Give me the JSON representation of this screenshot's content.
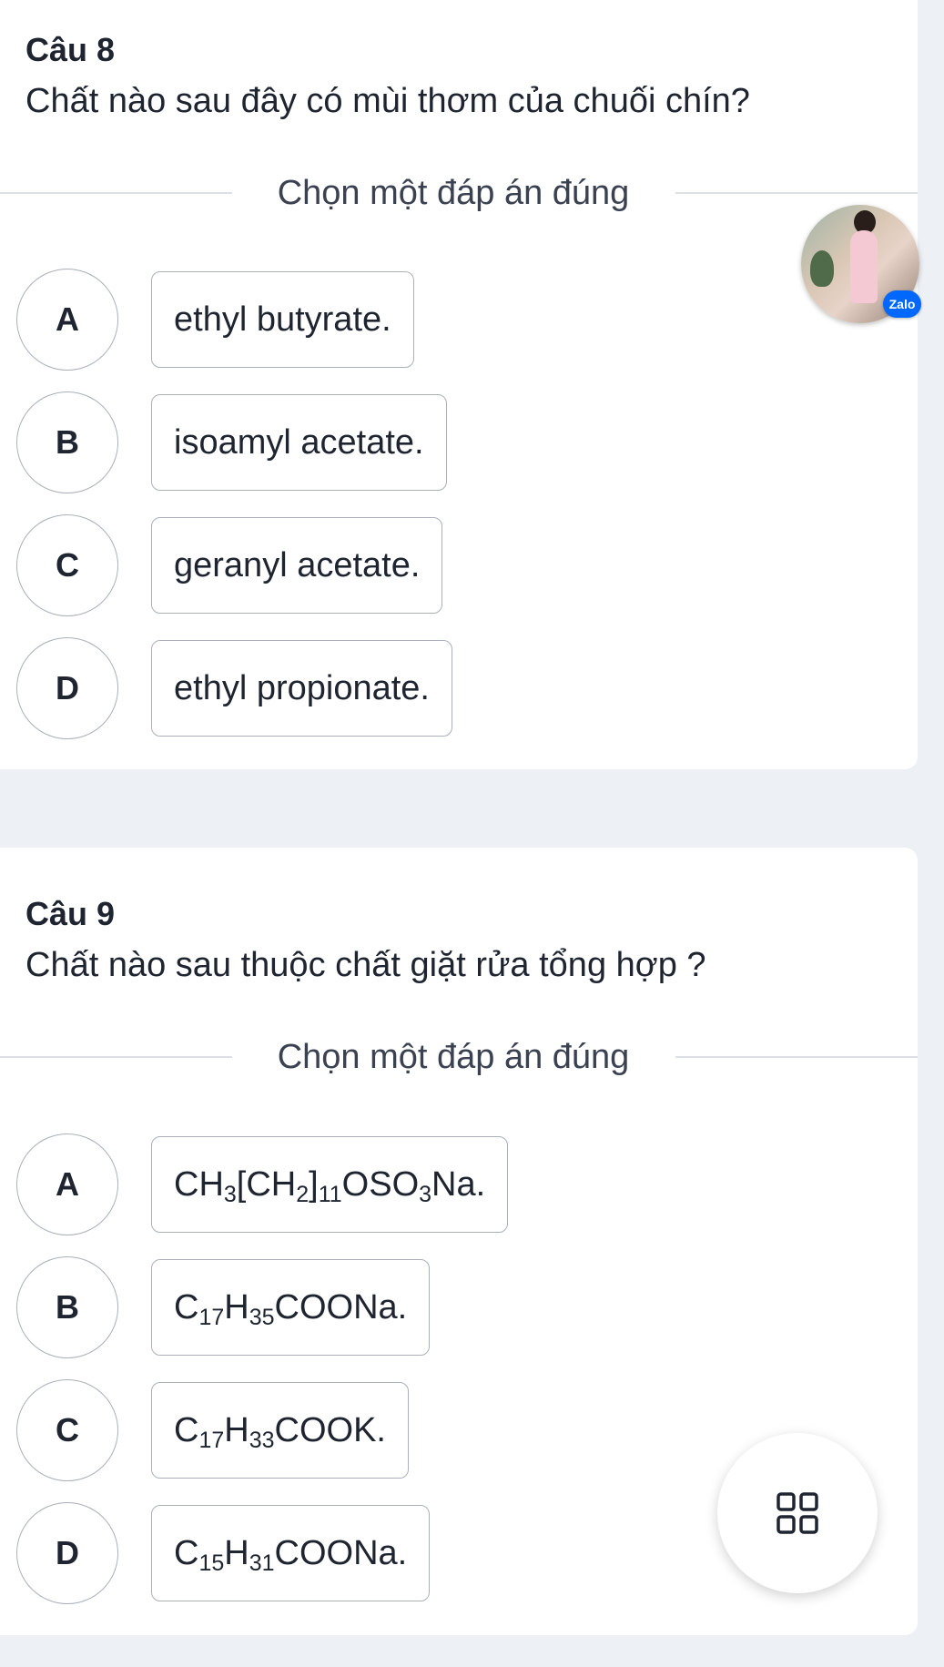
{
  "questions": [
    {
      "number": "Câu 8",
      "text": "Chất nào sau đây có mùi thơm của chuối chín?",
      "prompt": "Chọn một đáp án đúng",
      "options": [
        {
          "letter": "A",
          "text": "ethyl butyrate."
        },
        {
          "letter": "B",
          "text": "isoamyl acetate."
        },
        {
          "letter": "C",
          "text": "geranyl acetate."
        },
        {
          "letter": "D",
          "text": "ethyl propionate."
        }
      ]
    },
    {
      "number": "Câu 9",
      "text": "Chất nào sau thuộc chất giặt rửa tổng hợp ?",
      "prompt": "Chọn một đáp án đúng",
      "options": [
        {
          "letter": "A",
          "parts": [
            [
              "CH",
              "3"
            ],
            [
              "[CH",
              "2"
            ],
            [
              "]",
              "11"
            ],
            [
              "OSO",
              "3"
            ],
            [
              "Na.",
              ""
            ]
          ]
        },
        {
          "letter": "B",
          "parts": [
            [
              "C",
              "17"
            ],
            [
              "H",
              "35"
            ],
            [
              "COONa.",
              ""
            ]
          ]
        },
        {
          "letter": "C",
          "parts": [
            [
              "C",
              "17"
            ],
            [
              "H",
              "33"
            ],
            [
              "COOK.",
              ""
            ]
          ]
        },
        {
          "letter": "D",
          "parts": [
            [
              "C",
              "15"
            ],
            [
              "H",
              "31"
            ],
            [
              "COONa.",
              ""
            ]
          ]
        }
      ]
    }
  ],
  "zalo": {
    "badge_label": "Zalo",
    "badge_color": "#0068ff"
  },
  "floating_button": {
    "icon": "grid-icon"
  }
}
